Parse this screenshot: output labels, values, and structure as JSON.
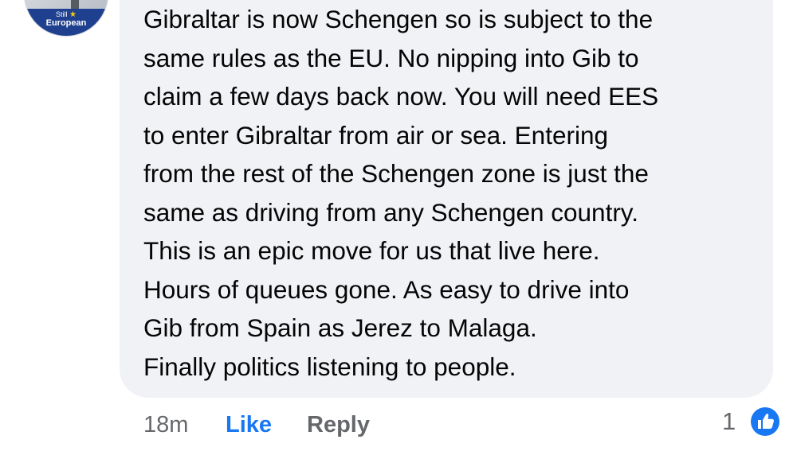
{
  "author": {
    "avatar_badge_line1": "Still",
    "avatar_badge_line2": "European"
  },
  "comment": {
    "lines": [
      "Gibraltar is now Schengen so is subject to the",
      "same rules as the EU. No nipping into Gib to",
      "claim a few days back now. You will need EES",
      "to enter Gibraltar from air or sea. Entering",
      "from the rest of the Schengen zone is just the",
      "same as driving from any Schengen country.",
      "This is an epic move for us that live here.",
      "Hours of queues gone. As easy to drive into",
      "Gib from Spain as Jerez to Malaga.",
      "Finally politics listening to people."
    ]
  },
  "actions": {
    "timestamp": "18m",
    "like_label": "Like",
    "reply_label": "Reply"
  },
  "reactions": {
    "count": "1",
    "icon": "thumbs-up-icon"
  },
  "colors": {
    "bubble_bg": "#f0f2f5",
    "like_blue": "#1877f2",
    "muted_text": "#65676b",
    "body_text": "#050505"
  }
}
